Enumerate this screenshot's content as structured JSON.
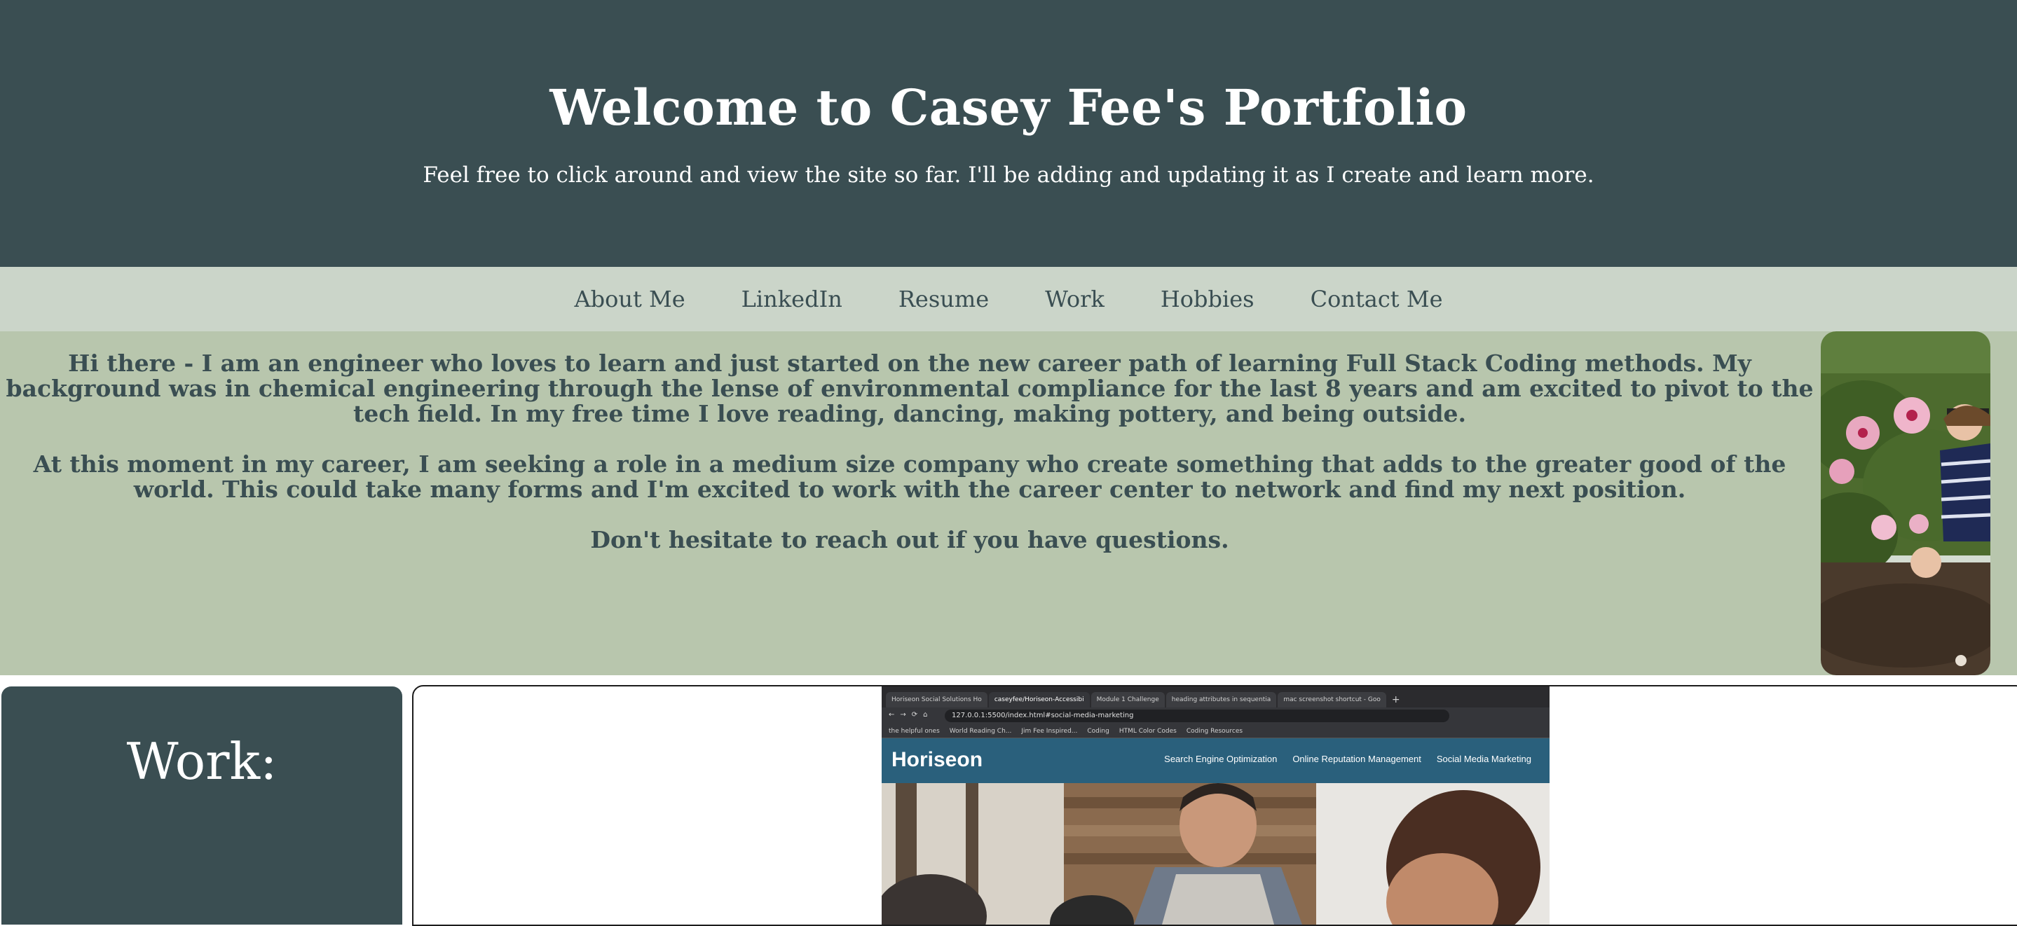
{
  "header": {
    "title": "Welcome to Casey Fee's Portfolio",
    "subtitle": "Feel free to click around and view the site so far. I'll be adding and updating it as I create and learn more."
  },
  "nav": {
    "items": [
      {
        "label": "About Me"
      },
      {
        "label": "LinkedIn"
      },
      {
        "label": "Resume"
      },
      {
        "label": "Work"
      },
      {
        "label": "Hobbies"
      },
      {
        "label": "Contact Me"
      }
    ]
  },
  "about": {
    "paragraphs": [
      "Hi there - I am an engineer who loves to learn and just started on the new career path of learning Full Stack Coding methods. My background was in chemical engineering through the lense of environmental compliance for the last 8 years and am excited to pivot to the tech field. In my free time I love reading, dancing, making pottery, and being outside.",
      "At this moment in my career, I am seeking a role in a medium size company who create something that adds to the greater good of the world. This could take many forms and I'm excited to work with the career center to network and find my next position.",
      "Don't hesitate to reach out if you have questions."
    ]
  },
  "work": {
    "heading": "Work:",
    "screenshot": {
      "tabs": [
        "Horiseon Social Solutions Ho",
        "caseyfee/Horiseon-Accessibi",
        "Module 1 Challenge",
        "heading attributes in sequentia",
        "mac screenshot shortcut - Goo"
      ],
      "url": "127.0.0.1:5500/index.html#social-media-marketing",
      "bookmarks": [
        "the helpful ones",
        "World Reading Ch...",
        "Jim Fee Inspired...",
        "Coding",
        "HTML Color Codes",
        "Coding Resources"
      ],
      "site_logo": "Horiseon",
      "site_links": [
        "Search Engine Optimization",
        "Online Reputation Management",
        "Social Media Marketing"
      ]
    }
  },
  "colors": {
    "header_bg": "#3a4e52",
    "nav_bg": "#cbd5c9",
    "about_bg": "#b8c6ad",
    "text_dark": "#3a4e52",
    "horiseon_blue": "#2a607c"
  }
}
